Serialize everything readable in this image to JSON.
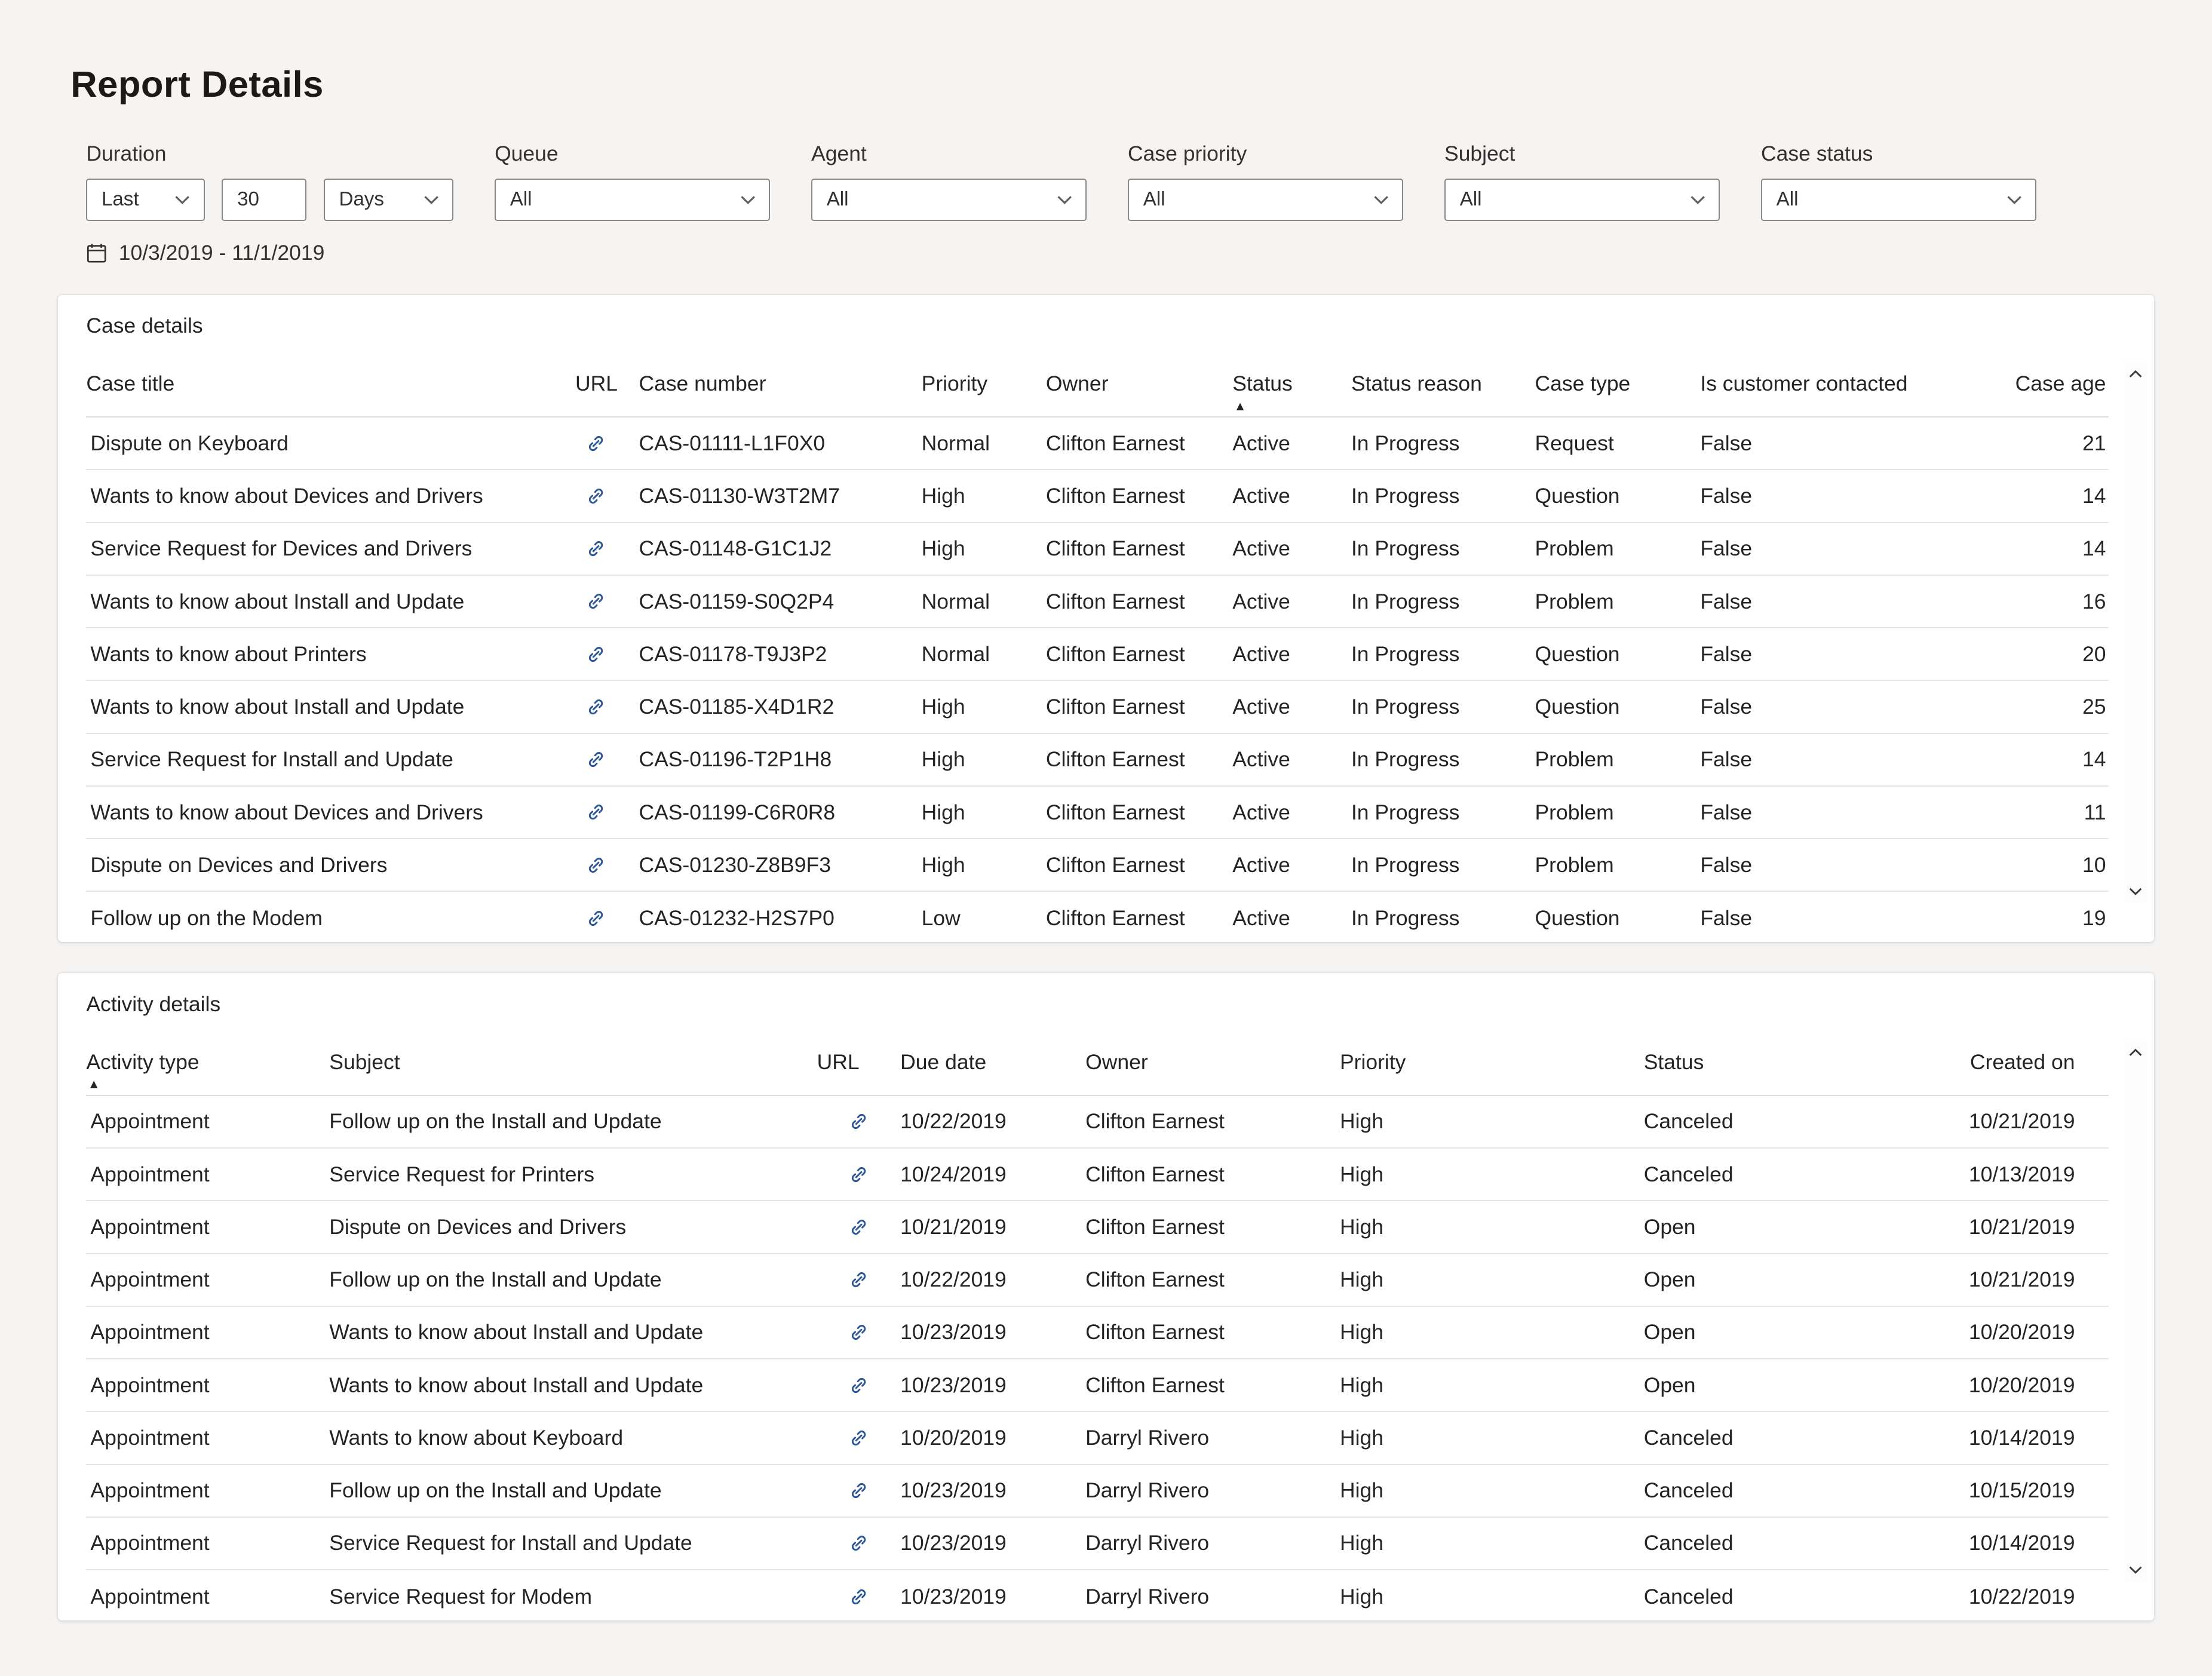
{
  "page": {
    "title": "Report Details"
  },
  "filters": {
    "duration": {
      "label": "Duration",
      "range_type": "Last",
      "amount": "30",
      "unit": "Days",
      "date_range": "10/3/2019 - 11/1/2019"
    },
    "others": [
      {
        "label": "Queue",
        "value": "All"
      },
      {
        "label": "Agent",
        "value": "All"
      },
      {
        "label": "Case priority",
        "value": "All"
      },
      {
        "label": "Subject",
        "value": "All"
      },
      {
        "label": "Case status",
        "value": "All"
      }
    ]
  },
  "case_table": {
    "title": "Case details",
    "columns": [
      "Case title",
      "URL",
      "Case number",
      "Priority",
      "Owner",
      "Status",
      "Status reason",
      "Case type",
      "Is customer contacted",
      "Case age"
    ],
    "sorted_column": "Status",
    "sort_direction": "ascending",
    "rows": [
      [
        "Dispute on Keyboard",
        "link",
        "CAS-01111-L1F0X0",
        "Normal",
        "Clifton Earnest",
        "Active",
        "In Progress",
        "Request",
        "False",
        "21"
      ],
      [
        "Wants to know about Devices and Drivers",
        "link",
        "CAS-01130-W3T2M7",
        "High",
        "Clifton Earnest",
        "Active",
        "In Progress",
        "Question",
        "False",
        "14"
      ],
      [
        "Service Request for Devices and Drivers",
        "link",
        "CAS-01148-G1C1J2",
        "High",
        "Clifton Earnest",
        "Active",
        "In Progress",
        "Problem",
        "False",
        "14"
      ],
      [
        "Wants to know about Install and Update",
        "link",
        "CAS-01159-S0Q2P4",
        "Normal",
        "Clifton Earnest",
        "Active",
        "In Progress",
        "Problem",
        "False",
        "16"
      ],
      [
        "Wants to know about Printers",
        "link",
        "CAS-01178-T9J3P2",
        "Normal",
        "Clifton Earnest",
        "Active",
        "In Progress",
        "Question",
        "False",
        "20"
      ],
      [
        "Wants to know about Install and Update",
        "link",
        "CAS-01185-X4D1R2",
        "High",
        "Clifton Earnest",
        "Active",
        "In Progress",
        "Question",
        "False",
        "25"
      ],
      [
        "Service Request for Install and Update",
        "link",
        "CAS-01196-T2P1H8",
        "High",
        "Clifton Earnest",
        "Active",
        "In Progress",
        "Problem",
        "False",
        "14"
      ],
      [
        "Wants to know about Devices and Drivers",
        "link",
        "CAS-01199-C6R0R8",
        "High",
        "Clifton Earnest",
        "Active",
        "In Progress",
        "Problem",
        "False",
        "11"
      ],
      [
        "Dispute on Devices and Drivers",
        "link",
        "CAS-01230-Z8B9F3",
        "High",
        "Clifton Earnest",
        "Active",
        "In Progress",
        "Problem",
        "False",
        "10"
      ],
      [
        "Follow up on the  Modem",
        "link",
        "CAS-01232-H2S7P0",
        "Low",
        "Clifton Earnest",
        "Active",
        "In Progress",
        "Question",
        "False",
        "19"
      ]
    ]
  },
  "activity_table": {
    "title": "Activity details",
    "columns": [
      "Activity type",
      "Subject",
      "URL",
      "Due date",
      "Owner",
      "Priority",
      "Status",
      "Created on"
    ],
    "sorted_column": "Activity type",
    "sort_direction": "ascending",
    "rows": [
      [
        "Appointment",
        "Follow up on the Install and Update",
        "link",
        "10/22/2019",
        "Clifton Earnest",
        "High",
        "Canceled",
        "10/21/2019"
      ],
      [
        "Appointment",
        "Service Request for Printers",
        "link",
        "10/24/2019",
        "Clifton Earnest",
        "High",
        "Canceled",
        "10/13/2019"
      ],
      [
        "Appointment",
        "Dispute on Devices and Drivers",
        "link",
        "10/21/2019",
        "Clifton Earnest",
        "High",
        "Open",
        "10/21/2019"
      ],
      [
        "Appointment",
        "Follow up on the Install and Update",
        "link",
        "10/22/2019",
        "Clifton Earnest",
        "High",
        "Open",
        "10/21/2019"
      ],
      [
        "Appointment",
        "Wants to know about Install and Update",
        "link",
        "10/23/2019",
        "Clifton Earnest",
        "High",
        "Open",
        "10/20/2019"
      ],
      [
        "Appointment",
        "Wants to know about Install and Update",
        "link",
        "10/23/2019",
        "Clifton Earnest",
        "High",
        "Open",
        "10/20/2019"
      ],
      [
        "Appointment",
        "Wants to know about Keyboard",
        "link",
        "10/20/2019",
        "Darryl Rivero",
        "High",
        "Canceled",
        "10/14/2019"
      ],
      [
        "Appointment",
        "Follow up on the Install and Update",
        "link",
        "10/23/2019",
        "Darryl Rivero",
        "High",
        "Canceled",
        "10/15/2019"
      ],
      [
        "Appointment",
        "Service Request for Install and Update",
        "link",
        "10/23/2019",
        "Darryl Rivero",
        "High",
        "Canceled",
        "10/14/2019"
      ],
      [
        "Appointment",
        "Service Request for Modem",
        "link",
        "10/23/2019",
        "Darryl Rivero",
        "High",
        "Canceled",
        "10/22/2019"
      ]
    ]
  },
  "colors": {
    "link_icon": "#2b5797",
    "background": "#f5f4f3",
    "card": "#ffffff",
    "text": "#252423"
  }
}
